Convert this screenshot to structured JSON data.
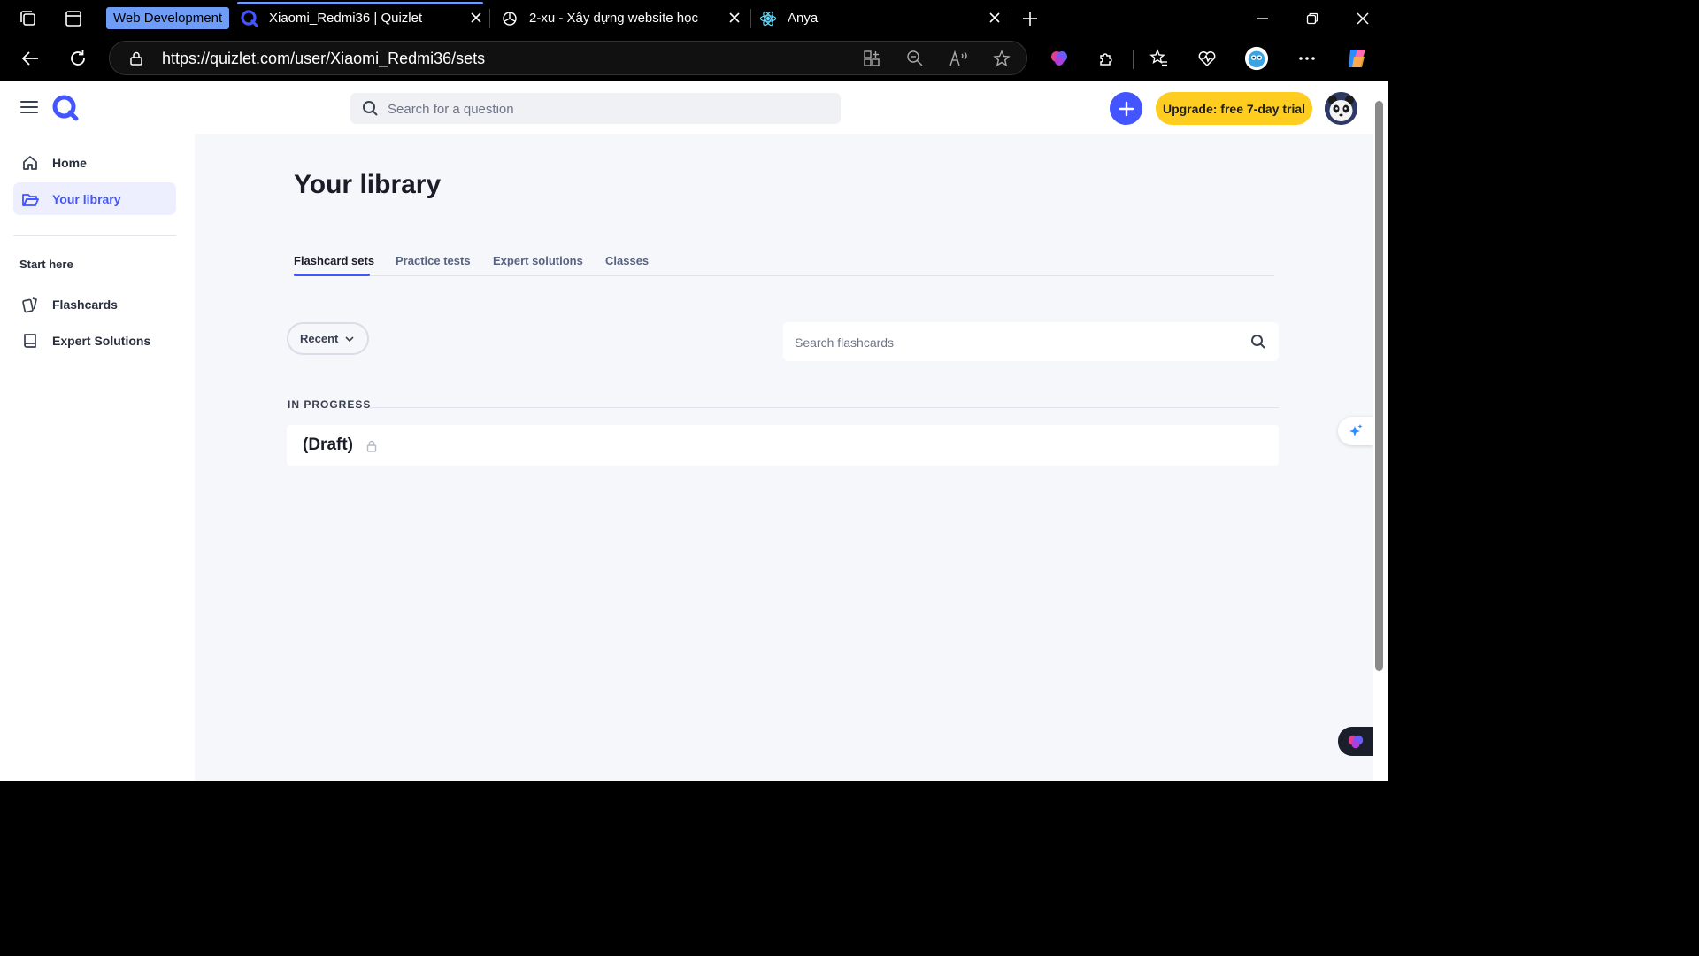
{
  "browser": {
    "tab_group_label": "Web Development",
    "tabs": [
      {
        "title": "Xiaomi_Redmi36 | Quizlet",
        "icon": "quizlet-icon",
        "active": true
      },
      {
        "title": "2-xu - Xây dựng website học",
        "icon": "chatgpt-icon",
        "active": false
      },
      {
        "title": "Anya",
        "icon": "react-icon",
        "active": false
      }
    ],
    "url": "https://quizlet.com/user/Xiaomi_Redmi36/sets"
  },
  "header": {
    "search_placeholder": "Search for a question",
    "upgrade_label": "Upgrade: free 7-day trial"
  },
  "sidebar": {
    "items": [
      {
        "label": "Home",
        "icon": "home-icon"
      },
      {
        "label": "Your library",
        "icon": "folder-icon",
        "active": true
      }
    ],
    "section_heading": "Start here",
    "start_items": [
      {
        "label": "Flashcards",
        "icon": "flashcards-icon"
      },
      {
        "label": "Expert Solutions",
        "icon": "book-icon"
      }
    ]
  },
  "main": {
    "title": "Your library",
    "tabs": [
      {
        "label": "Flashcard sets",
        "active": true
      },
      {
        "label": "Practice tests"
      },
      {
        "label": "Expert solutions"
      },
      {
        "label": "Classes"
      }
    ],
    "sort_label": "Recent",
    "search_placeholder": "Search flashcards",
    "section_label": "IN PROGRESS",
    "sets": [
      {
        "title": "(Draft)",
        "icon": "lock-icon"
      }
    ]
  },
  "colors": {
    "accent": "#4255ff",
    "upgrade": "#ffcd1f",
    "page_bg": "#f6f7fb",
    "tab_group": "#6f9cf7"
  }
}
